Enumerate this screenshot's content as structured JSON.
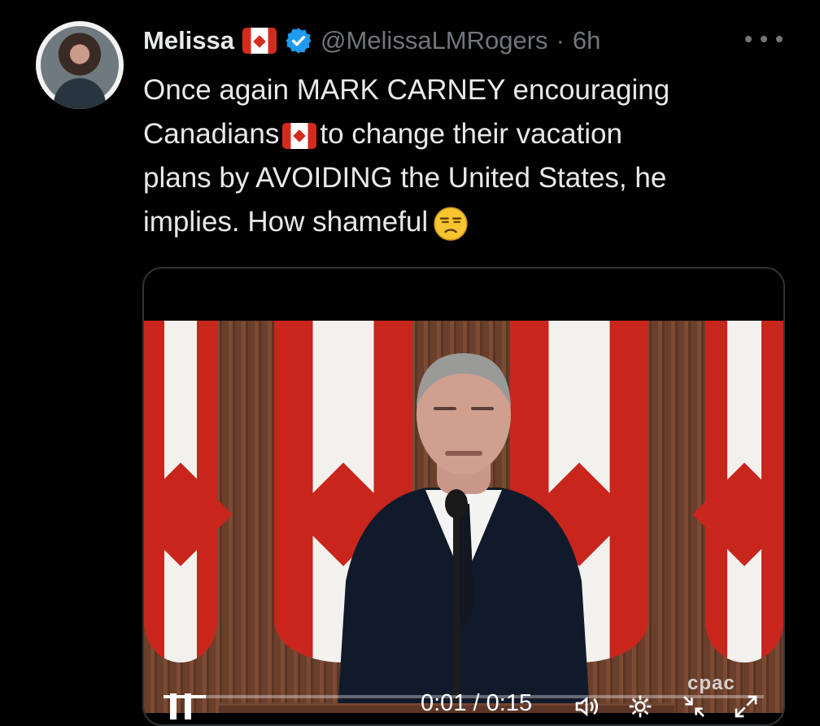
{
  "post": {
    "display_name": "Melissa",
    "handle": "@MelissaLMRogers",
    "separator": "·",
    "time_ago": "6h",
    "text_lines": [
      "Once again MARK CARNEY encouraging",
      "Canadians",
      "to change their vacation",
      "plans by AVOIDING the United States, he",
      "implies. How shameful"
    ],
    "emoji": "unamused-face"
  },
  "video": {
    "watermark": "cpac",
    "current_time": "0:01",
    "duration": "0:15",
    "time_separator": "/",
    "progress_fraction": 0.07
  },
  "colors": {
    "background": "#000000",
    "text": "#e7e9ea",
    "muted": "#71767b",
    "verified": "#1d9bf0",
    "canada_red": "#d52b1e"
  },
  "icons": {
    "more": "more-icon",
    "verified": "verified-badge-icon",
    "flag": "canada-flag-icon",
    "pause": "pause-icon",
    "volume": "volume-icon",
    "settings": "settings-icon",
    "collapse": "collapse-icon",
    "fullscreen": "fullscreen-icon"
  }
}
